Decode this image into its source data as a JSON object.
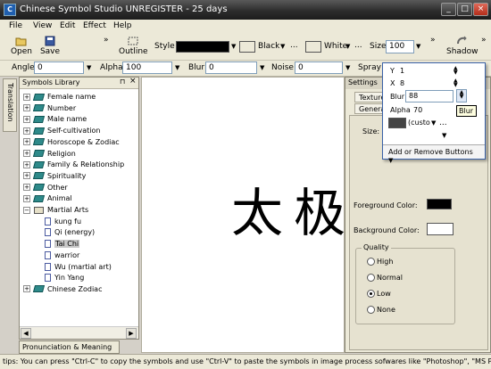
{
  "window": {
    "title": "Chinese Symbol Studio UNREGISTER - 25 days",
    "app_icon": "C"
  },
  "menu": [
    "File",
    "View",
    "Edit",
    "Effect",
    "Help"
  ],
  "toolbar1": {
    "open_label": "Open",
    "save_label": "Save",
    "outline_label": "Outline",
    "style_label": "Style",
    "color_value": "Black",
    "color_hex": "#000000",
    "bg_value": "White",
    "bg_hex": "#ffffff",
    "size_label": "Size",
    "size_value": "100",
    "shadow_label": "Shadow",
    "overflow": "»"
  },
  "toolbar2": {
    "angle_label": "Angle",
    "angle_value": "0",
    "alpha_label": "Alpha",
    "alpha_value": "100",
    "blur_label": "Blur",
    "blur_value": "0",
    "noise_label": "Noise",
    "noise_value": "0",
    "spray_label": "Spray"
  },
  "left_tab": "Translation",
  "library": {
    "title": "Symbols Library",
    "pin": "⊓",
    "close": "×",
    "items": [
      {
        "label": "Female name",
        "type": "book",
        "expander": "+"
      },
      {
        "label": "Number",
        "type": "book",
        "expander": "+"
      },
      {
        "label": "Male name",
        "type": "book",
        "expander": "+"
      },
      {
        "label": "Self-cultivation",
        "type": "book",
        "expander": "+"
      },
      {
        "label": "Horoscope & Zodiac",
        "type": "book",
        "expander": "+"
      },
      {
        "label": "Religion",
        "type": "book",
        "expander": "+"
      },
      {
        "label": "Family & Relationship",
        "type": "book",
        "expander": "+"
      },
      {
        "label": "Spirituality",
        "type": "book",
        "expander": "+"
      },
      {
        "label": "Other",
        "type": "book",
        "expander": "+"
      },
      {
        "label": "Animal",
        "type": "book",
        "expander": "+"
      },
      {
        "label": "Martial Arts",
        "type": "open",
        "expander": "−"
      },
      {
        "label": "kung fu",
        "type": "doc",
        "expander": ""
      },
      {
        "label": "Qi (energy)",
        "type": "doc",
        "expander": ""
      },
      {
        "label": "Tai Chi",
        "type": "doc",
        "expander": "",
        "selected": true
      },
      {
        "label": "warrior",
        "type": "doc",
        "expander": ""
      },
      {
        "label": "Wu (martial art)",
        "type": "doc",
        "expander": ""
      },
      {
        "label": "Yin Yang",
        "type": "doc",
        "expander": ""
      },
      {
        "label": "Chinese Zodiac",
        "type": "book",
        "expander": "+"
      }
    ]
  },
  "bottom_tab": "Pronunciation & Meaning",
  "canvas": {
    "characters": "太极"
  },
  "settings": {
    "title": "Settings",
    "tab_texture": "Texture",
    "tab_general": "General",
    "size_label": "Size:",
    "foreground_label": "Foreground Color:",
    "foreground_hex": "#000000",
    "background_label": "Background Color:",
    "background_hex": "#ffffff",
    "quality_label": "Quality",
    "quality_options": [
      "High",
      "Normal",
      "Low",
      "None"
    ],
    "quality_selected": "Low"
  },
  "popup": {
    "y_label": "Y",
    "y_value": "1",
    "x_label": "X",
    "x_value": "8",
    "blur_label": "Blur",
    "blur_value": "88",
    "alpha_label": "Alpha",
    "alpha_value": "70",
    "color_value": "(custo",
    "add_remove_label": "Add or Remove Buttons"
  },
  "tooltip": "Blur",
  "status": "tips: You can press \"Ctrl-C\" to copy the symbols and use \"Ctrl-V\" to paste the symbols in image process sofwares like \"Photoshop\", \"MS Paint\""
}
